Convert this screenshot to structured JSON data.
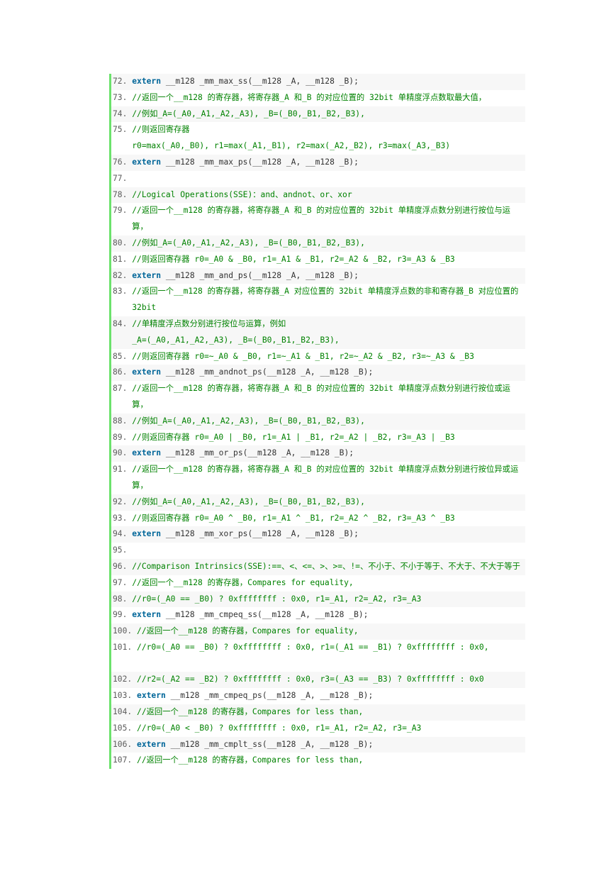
{
  "lines": [
    {
      "n": "72.",
      "parts": [
        {
          "t": "keyword",
          "s": "extern"
        },
        {
          "t": "plain",
          "s": " __m128 _mm_max_ss(__m128 _A, __m128 _B);"
        }
      ]
    },
    {
      "n": "73.",
      "parts": [
        {
          "t": "comment",
          "s": "//返回一个__m128 的寄存器，将寄存器_A 和_B 的对应位置的 32bit 单精度浮点数取最大值，"
        }
      ]
    },
    {
      "n": "74.",
      "parts": [
        {
          "t": "comment",
          "s": "//例如_A=(_A0,_A1,_A2,_A3), _B=(_B0,_B1,_B2,_B3),"
        }
      ]
    },
    {
      "n": "75.",
      "parts": [
        {
          "t": "comment",
          "s": "//则返回寄存器\nr0=max(_A0,_B0), r1=max(_A1,_B1), r2=max(_A2,_B2), r3=max(_A3,_B3)"
        }
      ]
    },
    {
      "n": "76.",
      "parts": [
        {
          "t": "keyword",
          "s": "extern"
        },
        {
          "t": "plain",
          "s": " __m128 _mm_max_ps(__m128 _A, __m128 _B);"
        }
      ]
    },
    {
      "n": "77.",
      "parts": []
    },
    {
      "n": "78.",
      "parts": [
        {
          "t": "comment",
          "s": "//Logical Operations(SSE)：and、andnot、or、xor"
        }
      ]
    },
    {
      "n": "79.",
      "parts": [
        {
          "t": "comment",
          "s": "//返回一个__m128 的寄存器，将寄存器_A 和_B 的对应位置的 32bit 单精度浮点数分别进行按位与运算，"
        }
      ]
    },
    {
      "n": "80.",
      "parts": [
        {
          "t": "comment",
          "s": "//例如_A=(_A0,_A1,_A2,_A3), _B=(_B0,_B1,_B2,_B3),"
        }
      ]
    },
    {
      "n": "81.",
      "parts": [
        {
          "t": "comment",
          "s": "//则返回寄存器 r0=_A0 & _B0, r1=_A1 & _B1, r2=_A2 & _B2, r3=_A3 & _B3"
        }
      ]
    },
    {
      "n": "82.",
      "parts": [
        {
          "t": "keyword",
          "s": "extern"
        },
        {
          "t": "plain",
          "s": " __m128 _mm_and_ps(__m128 _A, __m128 _B);"
        }
      ]
    },
    {
      "n": "83.",
      "parts": [
        {
          "t": "comment",
          "s": "//返回一个__m128 的寄存器，将寄存器_A 对应位置的 32bit 单精度浮点数的非和寄存器_B 对应位置的 32bit"
        }
      ]
    },
    {
      "n": "84.",
      "parts": [
        {
          "t": "comment",
          "s": "//单精度浮点数分别进行按位与运算，例如\n_A=(_A0,_A1,_A2,_A3), _B=(_B0,_B1,_B2,_B3),"
        }
      ]
    },
    {
      "n": "85.",
      "parts": [
        {
          "t": "comment",
          "s": "//则返回寄存器 r0=~_A0 & _B0, r1=~_A1 & _B1, r2=~_A2 & _B2, r3=~_A3 & _B3"
        }
      ]
    },
    {
      "n": "86.",
      "parts": [
        {
          "t": "keyword",
          "s": "extern"
        },
        {
          "t": "plain",
          "s": " __m128 _mm_andnot_ps(__m128 _A, __m128 _B);"
        }
      ]
    },
    {
      "n": "87.",
      "parts": [
        {
          "t": "comment",
          "s": "//返回一个__m128 的寄存器，将寄存器_A 和_B 的对应位置的 32bit 单精度浮点数分别进行按位或运算，"
        }
      ]
    },
    {
      "n": "88.",
      "parts": [
        {
          "t": "comment",
          "s": "//例如_A=(_A0,_A1,_A2,_A3), _B=(_B0,_B1,_B2,_B3),"
        }
      ]
    },
    {
      "n": "89.",
      "parts": [
        {
          "t": "comment",
          "s": "//则返回寄存器 r0=_A0 | _B0, r1=_A1 | _B1, r2=_A2 | _B2, r3=_A3 | _B3"
        }
      ]
    },
    {
      "n": "90.",
      "parts": [
        {
          "t": "keyword",
          "s": "extern"
        },
        {
          "t": "plain",
          "s": " __m128 _mm_or_ps(__m128 _A, __m128 _B);"
        }
      ]
    },
    {
      "n": "91.",
      "parts": [
        {
          "t": "comment",
          "s": "//返回一个__m128 的寄存器，将寄存器_A 和_B 的对应位置的 32bit 单精度浮点数分别进行按位异或运算，"
        }
      ]
    },
    {
      "n": "92.",
      "parts": [
        {
          "t": "comment",
          "s": "//例如_A=(_A0,_A1,_A2,_A3), _B=(_B0,_B1,_B2,_B3),"
        }
      ]
    },
    {
      "n": "93.",
      "parts": [
        {
          "t": "comment",
          "s": "//则返回寄存器 r0=_A0 ^ _B0, r1=_A1 ^ _B1, r2=_A2 ^ _B2, r3=_A3 ^ _B3"
        }
      ]
    },
    {
      "n": "94.",
      "parts": [
        {
          "t": "keyword",
          "s": "extern"
        },
        {
          "t": "plain",
          "s": " __m128 _mm_xor_ps(__m128 _A, __m128 _B);"
        }
      ]
    },
    {
      "n": "95.",
      "parts": []
    },
    {
      "n": "96.",
      "parts": [
        {
          "t": "comment",
          "s": "//Comparison Intrinsics(SSE):==、<、<=、>、>=、!=、不小于、不小于等于、不大于、不大于等于"
        }
      ]
    },
    {
      "n": "97.",
      "parts": [
        {
          "t": "comment",
          "s": "//返回一个__m128 的寄存器，Compares for equality,"
        }
      ]
    },
    {
      "n": "98.",
      "parts": [
        {
          "t": "comment",
          "s": "//r0=(_A0 == _B0) ? 0xffffffff : 0x0, r1=_A1, r2=_A2, r3=_A3"
        }
      ]
    },
    {
      "n": "99.",
      "parts": [
        {
          "t": "keyword",
          "s": "extern"
        },
        {
          "t": "plain",
          "s": " __m128 _mm_cmpeq_ss(__m128 _A, __m128 _B);"
        }
      ]
    },
    {
      "n": "100.",
      "parts": [
        {
          "t": "comment",
          "s": "//返回一个__m128 的寄存器，Compares for equality,"
        }
      ]
    },
    {
      "n": "101.",
      "parts": [
        {
          "t": "comment",
          "s": "//r0=(_A0 == _B0) ? 0xffffffff : 0x0, r1=(_A1 == _B1) ? 0xffffffff : 0x0,\n "
        }
      ]
    },
    {
      "n": "102.",
      "parts": [
        {
          "t": "comment",
          "s": "//r2=(_A2 == _B2) ? 0xffffffff : 0x0, r3=(_A3 == _B3) ? 0xffffffff : 0x0"
        }
      ]
    },
    {
      "n": "103.",
      "parts": [
        {
          "t": "keyword",
          "s": "extern"
        },
        {
          "t": "plain",
          "s": " __m128 _mm_cmpeq_ps(__m128 _A, __m128 _B);"
        }
      ]
    },
    {
      "n": "104.",
      "parts": [
        {
          "t": "comment",
          "s": "//返回一个__m128 的寄存器，Compares for less than,"
        }
      ]
    },
    {
      "n": "105.",
      "parts": [
        {
          "t": "comment",
          "s": "//r0=(_A0 < _B0) ? 0xffffffff : 0x0, r1=_A1, r2=_A2, r3=_A3"
        }
      ]
    },
    {
      "n": "106.",
      "parts": [
        {
          "t": "keyword",
          "s": "extern"
        },
        {
          "t": "plain",
          "s": " __m128 _mm_cmplt_ss(__m128 _A, __m128 _B);"
        }
      ]
    },
    {
      "n": "107.",
      "parts": [
        {
          "t": "comment",
          "s": "//返回一个__m128 的寄存器，Compares for less than,"
        }
      ]
    }
  ]
}
